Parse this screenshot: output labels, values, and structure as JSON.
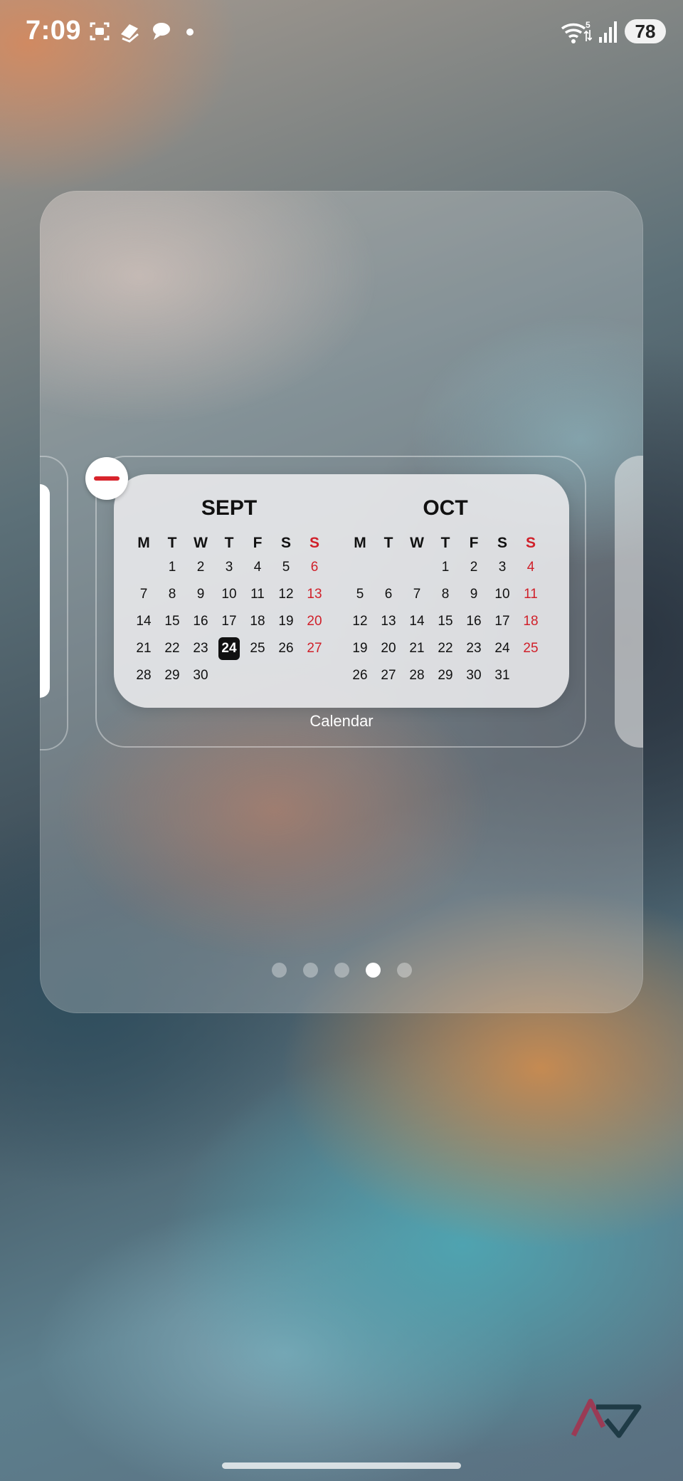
{
  "status_bar": {
    "time": "7:09",
    "battery": "78",
    "icons": [
      "screenshot-icon",
      "layers-app-icon",
      "chat-bubble-icon",
      "notification-dot",
      "wifi-5-icon",
      "signal-bars-icon",
      "battery-icon"
    ]
  },
  "widget": {
    "label": "Calendar",
    "selected_date": "24",
    "sunday_color": "#d0202a",
    "months": [
      {
        "name": "SEPT",
        "dow": [
          "M",
          "T",
          "W",
          "T",
          "F",
          "S",
          "S"
        ],
        "weeks": [
          [
            "",
            "1",
            "2",
            "3",
            "4",
            "5",
            "6"
          ],
          [
            "7",
            "8",
            "9",
            "10",
            "11",
            "12",
            "13"
          ],
          [
            "14",
            "15",
            "16",
            "17",
            "18",
            "19",
            "20"
          ],
          [
            "21",
            "22",
            "23",
            "24",
            "25",
            "26",
            "27"
          ],
          [
            "28",
            "29",
            "30",
            "",
            "",
            "",
            ""
          ]
        ]
      },
      {
        "name": "OCT",
        "dow": [
          "M",
          "T",
          "W",
          "T",
          "F",
          "S",
          "S"
        ],
        "weeks": [
          [
            "",
            "",
            "",
            "1",
            "2",
            "3",
            "4"
          ],
          [
            "5",
            "6",
            "7",
            "8",
            "9",
            "10",
            "11"
          ],
          [
            "12",
            "13",
            "14",
            "15",
            "16",
            "17",
            "18"
          ],
          [
            "19",
            "20",
            "21",
            "22",
            "23",
            "24",
            "25"
          ],
          [
            "26",
            "27",
            "28",
            "29",
            "30",
            "31",
            ""
          ]
        ]
      }
    ]
  },
  "pager": {
    "count": 5,
    "active_index": 3
  }
}
